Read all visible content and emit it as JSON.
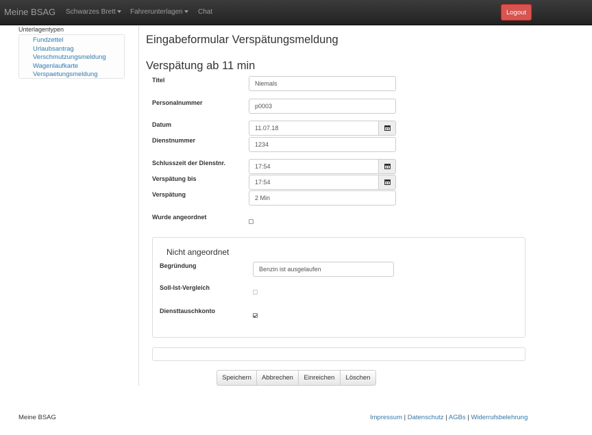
{
  "navbar": {
    "brand": "Meine BSAG",
    "items": [
      "Schwarzes Brett",
      "Fahrerunterlagen",
      "Chat"
    ],
    "logout": "Logout"
  },
  "sidebar": {
    "heading": "Unterlagentypen",
    "items": [
      "Fundzettel",
      "Urlaubsantrag",
      "Verschmutzungsmeldung",
      "Wagenlaufkarte",
      "Verspaetungsmeldung"
    ]
  },
  "main": {
    "page_title": "Eingabeformular Verspätungsmeldung",
    "section_title": "Verspätung ab 11 min",
    "fields": {
      "titel": {
        "label": "Titel",
        "value": "Niemals"
      },
      "personalnummer": {
        "label": "Personalnummer",
        "value": "p0003"
      },
      "datum": {
        "label": "Datum",
        "value": "11.07.18"
      },
      "dienstnummer": {
        "label": "Dienstnummer",
        "value": "1234"
      },
      "schlusszeit": {
        "label": "Schlusszeit der Dienstnr.",
        "value": "17:54"
      },
      "verspaetung_bis": {
        "label": "Verspätung bis",
        "value": "17:54"
      },
      "verspaetung": {
        "label": "Verspätung",
        "value": "2 Min"
      },
      "wurde_angeordnet": {
        "label": "Wurde angeordnet",
        "checked": false
      }
    },
    "panel": {
      "title": "Nicht angeordnet",
      "begruendung": {
        "label": "Begründung",
        "value": "Benzin ist ausgelaufen"
      },
      "soll_ist": {
        "label": "Soll-Ist-Vergleich",
        "checked": false,
        "disabled": true
      },
      "diensttausch": {
        "label": "Diensttauschkonto",
        "checked": true
      }
    },
    "buttons": {
      "save": "Speichern",
      "cancel": "Abbrechen",
      "submit": "Einreichen",
      "delete": "Löschen"
    }
  },
  "footer": {
    "brand": "Meine BSAG",
    "links": [
      "Impressum",
      "Datenschutz",
      "AGBs",
      "Widerrufsbelehrung"
    ],
    "separator": " | "
  },
  "colors": {
    "navbar": "#222222",
    "logout": "#d9534f",
    "link": "#337ab7"
  },
  "icons": {
    "calendar": "calendar-icon",
    "caret": "chevron-down-icon"
  }
}
